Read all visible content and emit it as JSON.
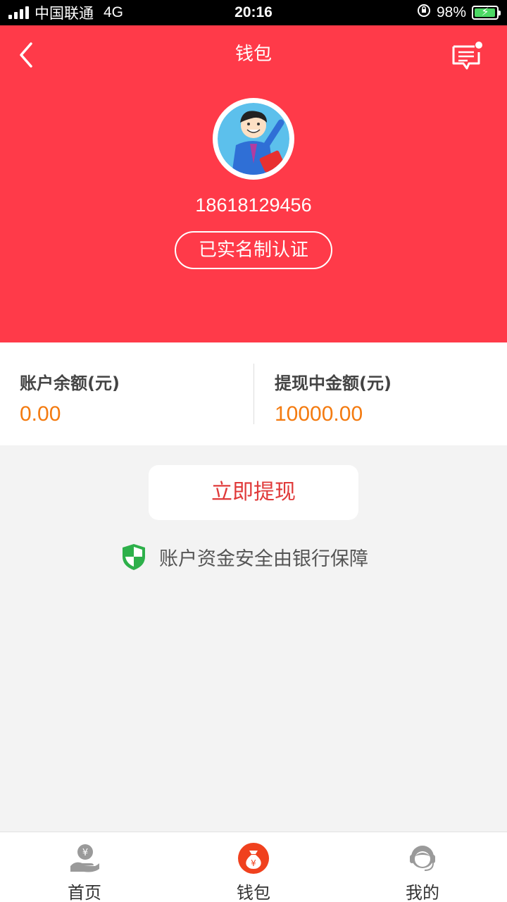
{
  "status_bar": {
    "carrier": "中国联通",
    "network": "4G",
    "time": "20:16",
    "battery_percent": "98%",
    "battery_level": 0.98
  },
  "header": {
    "title": "钱包",
    "back_icon": "chevron-left-icon",
    "message_icon": "message-icon"
  },
  "profile": {
    "avatar_icon": "cartoon-avatar",
    "phone": "18618129456",
    "verify_label": "已实名制认证"
  },
  "balance": {
    "account_label": "账户余额(元)",
    "account_value": "0.00",
    "withdrawing_label": "提现中金额(元)",
    "withdrawing_value": "10000.00"
  },
  "actions": {
    "withdraw_label": "立即提现"
  },
  "security": {
    "icon": "shield-icon",
    "text": "账户资金安全由银行保障"
  },
  "tabbar": {
    "items": [
      {
        "label": "首页",
        "icon": "hand-coin-icon",
        "active": false
      },
      {
        "label": "钱包",
        "icon": "money-bag-icon",
        "active": true
      },
      {
        "label": "我的",
        "icon": "user-headset-icon",
        "active": false
      }
    ]
  },
  "colors": {
    "header_bg": "#ff3a49",
    "amount": "#f47b10",
    "withdraw_text": "#e03a3a",
    "active_tab": "#f0411e"
  }
}
